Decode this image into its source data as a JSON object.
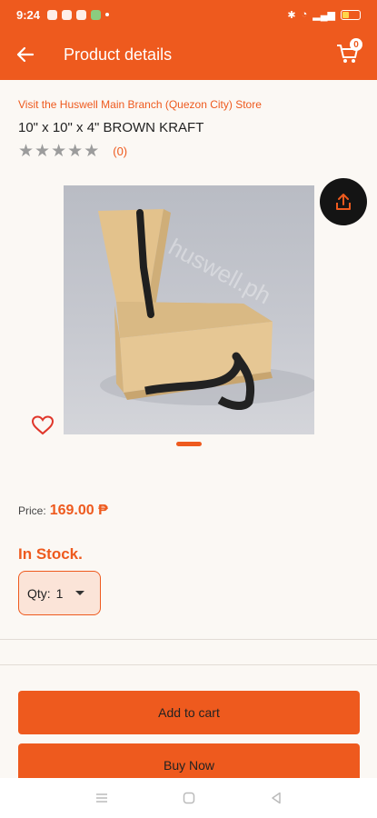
{
  "status_bar": {
    "time": "9:24"
  },
  "header": {
    "title": "Product details",
    "cart_count": "0"
  },
  "product": {
    "store_link": "Visit the Huswell Main Branch (Quezon City) Store",
    "name": "10\" x 10\" x 4\" BROWN KRAFT",
    "rating_count": "(0)",
    "star_rating": 0,
    "watermark": "huswell.ph"
  },
  "price": {
    "label": "Price:",
    "value": "169.00 ₱"
  },
  "stock_status": "In Stock.",
  "quantity": {
    "label": "Qty:",
    "value": "1"
  },
  "actions": {
    "add_to_cart": "Add to cart",
    "buy_now": "Buy Now"
  },
  "colors": {
    "accent": "#ee5a1e",
    "background": "#fbf8f4"
  }
}
